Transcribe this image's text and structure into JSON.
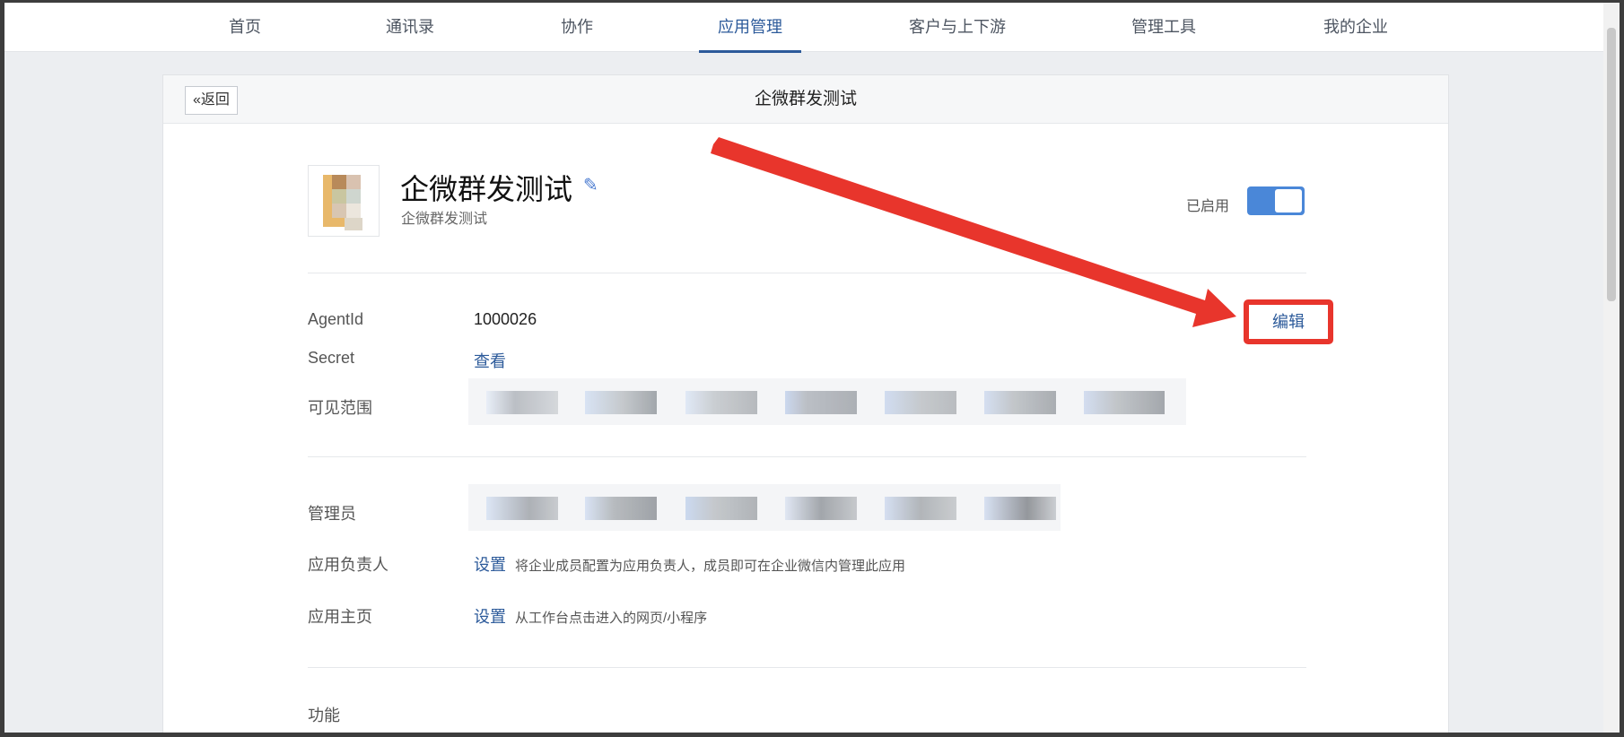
{
  "nav": {
    "items": [
      {
        "label": "首页"
      },
      {
        "label": "通讯录"
      },
      {
        "label": "协作"
      },
      {
        "label": "应用管理",
        "active": true
      },
      {
        "label": "客户与上下游"
      },
      {
        "label": "管理工具"
      },
      {
        "label": "我的企业"
      }
    ]
  },
  "header": {
    "back_label": "«返回",
    "title": "企微群发测试"
  },
  "app": {
    "name": "企微群发测试",
    "description": "企微群发测试",
    "status_label": "已启用",
    "enabled": true,
    "edit_label": "编辑"
  },
  "details": {
    "agentid_label": "AgentId",
    "agentid_value": "1000026",
    "secret_label": "Secret",
    "secret_link": "查看",
    "visible_label": "可见范围",
    "admin_label": "管理员",
    "owner_label": "应用负责人",
    "owner_link": "设置",
    "owner_hint": "将企业成员配置为应用负责人，成员即可在企业微信内管理此应用",
    "homepage_label": "应用主页",
    "homepage_link": "设置",
    "homepage_hint": "从工作台点击进入的网页/小程序",
    "features_label": "功能"
  },
  "colors": {
    "accent": "#2c5a9a",
    "toggle": "#4a87d8",
    "annotation": "#e8352c"
  }
}
